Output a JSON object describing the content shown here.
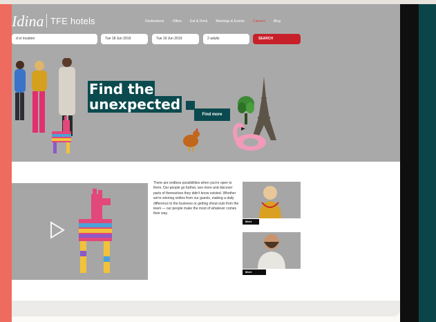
{
  "header": {
    "logo_script": "Idina",
    "brand": "TFE hotels"
  },
  "nav": {
    "items": [
      {
        "label": "Destinations"
      },
      {
        "label": "Offers"
      },
      {
        "label": "Eat & Drink"
      },
      {
        "label": "Meetings & Events"
      },
      {
        "label": "Careers",
        "active": true
      },
      {
        "label": "Blog"
      }
    ],
    "active_color": "#e0433c"
  },
  "booking": {
    "location_placeholder": "d or location",
    "checkin": "Tue 18 Jun 2019",
    "checkout": "Tue 19 Jun 2019",
    "guests": "2 adults",
    "search_label": "SEARCH"
  },
  "hero": {
    "line1": "Find the",
    "line2": "unexpected",
    "cta": "Find more"
  },
  "body": {
    "text": "There are endless possibilities when you're open to them. Our people go further, see more and discover parts of themselves they didn't know existed. Whether we're winning smiles from our guests, making a daily difference to the business or getting shout outs from the team — our people make the most of whatever comes their way."
  },
  "team": [
    {
      "name": "Meet Jane"
    },
    {
      "name": "Meet Benjamin"
    }
  ],
  "colors": {
    "accent_teal": "#0b4a4e",
    "search_red": "#c8202a",
    "frame_salmon": "#ef6b5f"
  }
}
